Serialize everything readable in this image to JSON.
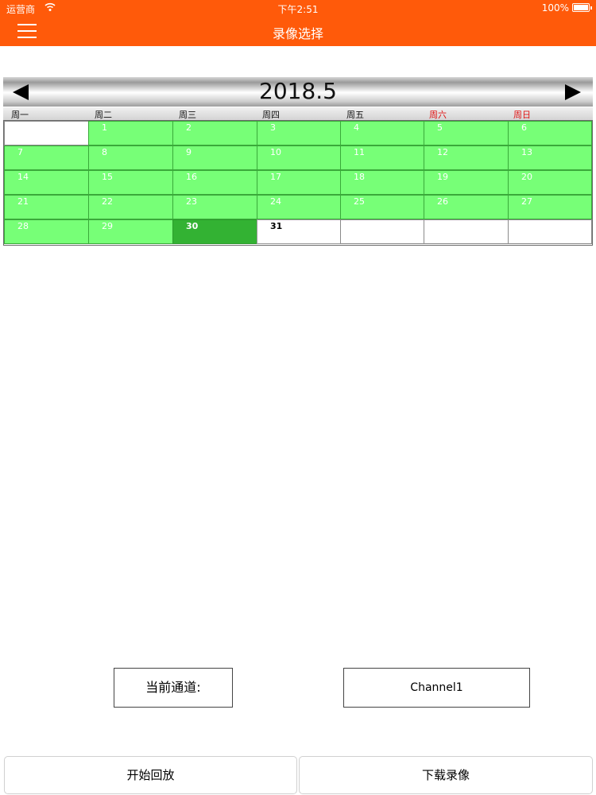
{
  "status_bar": {
    "carrier": "运营商",
    "time": "下午2:51",
    "battery": "100%"
  },
  "nav": {
    "title": "录像选择",
    "menu_icon": "hamburger-menu-icon"
  },
  "calendar": {
    "month_label": "2018.5",
    "weekdays": [
      "周一",
      "周二",
      "周三",
      "周四",
      "周五",
      "周六",
      "周日"
    ],
    "weekend_color": "#e01010",
    "record_color": "#77ff77",
    "selected_color": "#33b233",
    "days_with_recordings": [
      1,
      2,
      3,
      4,
      5,
      6,
      7,
      8,
      9,
      10,
      11,
      12,
      13,
      14,
      15,
      16,
      17,
      18,
      19,
      20,
      21,
      22,
      23,
      24,
      25,
      26,
      27,
      28,
      29,
      30
    ],
    "selected_day": 30,
    "cells": [
      "",
      "1",
      "2",
      "3",
      "4",
      "5",
      "6",
      "7",
      "8",
      "9",
      "10",
      "11",
      "12",
      "13",
      "14",
      "15",
      "16",
      "17",
      "18",
      "19",
      "20",
      "21",
      "22",
      "23",
      "24",
      "25",
      "26",
      "27",
      "28",
      "29",
      "30",
      "31",
      "",
      "",
      ""
    ]
  },
  "channel": {
    "label": "当前通道:",
    "value": "Channel1"
  },
  "actions": {
    "playback": "开始回放",
    "download": "下载录像"
  }
}
